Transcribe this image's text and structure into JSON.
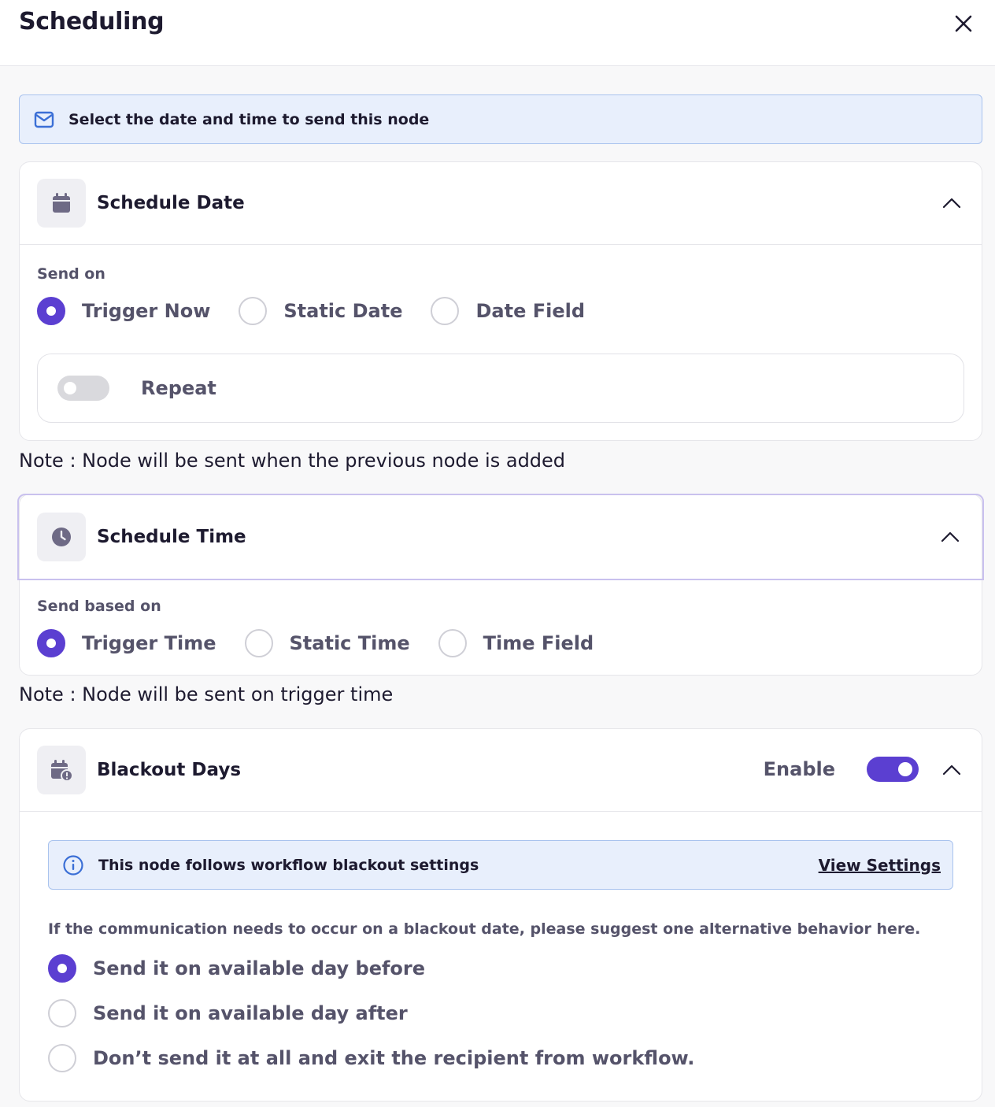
{
  "header": {
    "title": "Scheduling"
  },
  "info_banner": {
    "text": "Select the date and time to send this node"
  },
  "schedule_date": {
    "title": "Schedule Date",
    "field_label": "Send on",
    "options": [
      "Trigger Now",
      "Static Date",
      "Date Field"
    ],
    "selected": "Trigger Now",
    "repeat_label": "Repeat",
    "repeat_enabled": false,
    "note": "Note : Node will be sent when the previous node is added"
  },
  "schedule_time": {
    "title": "Schedule Time",
    "field_label": "Send based on",
    "options": [
      "Trigger Time",
      "Static Time",
      "Time Field"
    ],
    "selected": "Trigger Time",
    "note": "Note : Node will be sent on trigger time"
  },
  "blackout_days": {
    "title": "Blackout Days",
    "enable_label": "Enable",
    "enabled": true,
    "banner_text": "This node follows workflow blackout settings",
    "banner_link": "View Settings",
    "hint": "If the communication needs to occur on a blackout date, please suggest one alternative behavior here.",
    "options": [
      "Send it on available day before",
      "Send it on available day after",
      "Don’t send it at all and exit the recipient from workflow."
    ],
    "selected": "Send it on available day before"
  },
  "colors": {
    "accent": "#5b3fd1",
    "banner_bg": "#e8effc",
    "banner_border": "#a9c3ee",
    "text_muted": "#55536a"
  }
}
